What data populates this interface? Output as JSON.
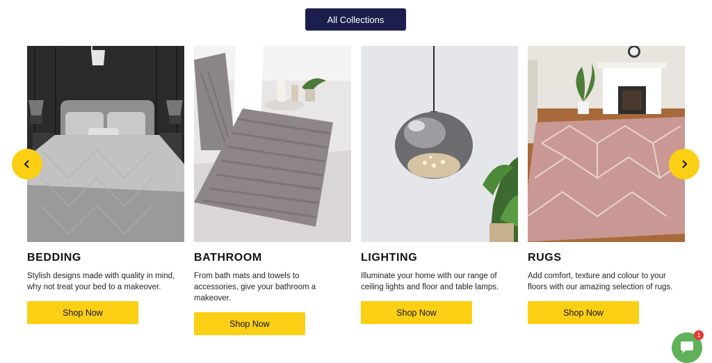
{
  "header": {
    "all_collections_label": "All Collections"
  },
  "carousel": {
    "prev_icon": "chevron-left-icon",
    "next_icon": "chevron-right-icon",
    "accent_color": "#fbcf13",
    "cards": [
      {
        "title": "BEDDING",
        "description": "Stylish designs made with quality in mind, why not treat your bed to a makeover.",
        "button_label": "Shop Now",
        "image": "bedding-photo"
      },
      {
        "title": "BATHROOM",
        "description": "From bath mats and towels to accessories, give your bathroom a makeover.",
        "button_label": "Shop Now",
        "image": "bath-mat-photo"
      },
      {
        "title": "LIGHTING",
        "description": "Illuminate your home with our range of ceiling lights and floor and table lamps.",
        "button_label": "Shop Now",
        "image": "pendant-light-photo"
      },
      {
        "title": "RUGS",
        "description": "Add comfort, texture and colour to your floors with our amazing selection of rugs.",
        "button_label": "Shop Now",
        "image": "rug-photo"
      }
    ]
  },
  "chat": {
    "icon": "chat-bubble-icon",
    "badge_count": "1",
    "color": "#5fb15a"
  },
  "brand_colors": {
    "navy": "#1c1f4d",
    "yellow": "#fbcf13"
  }
}
